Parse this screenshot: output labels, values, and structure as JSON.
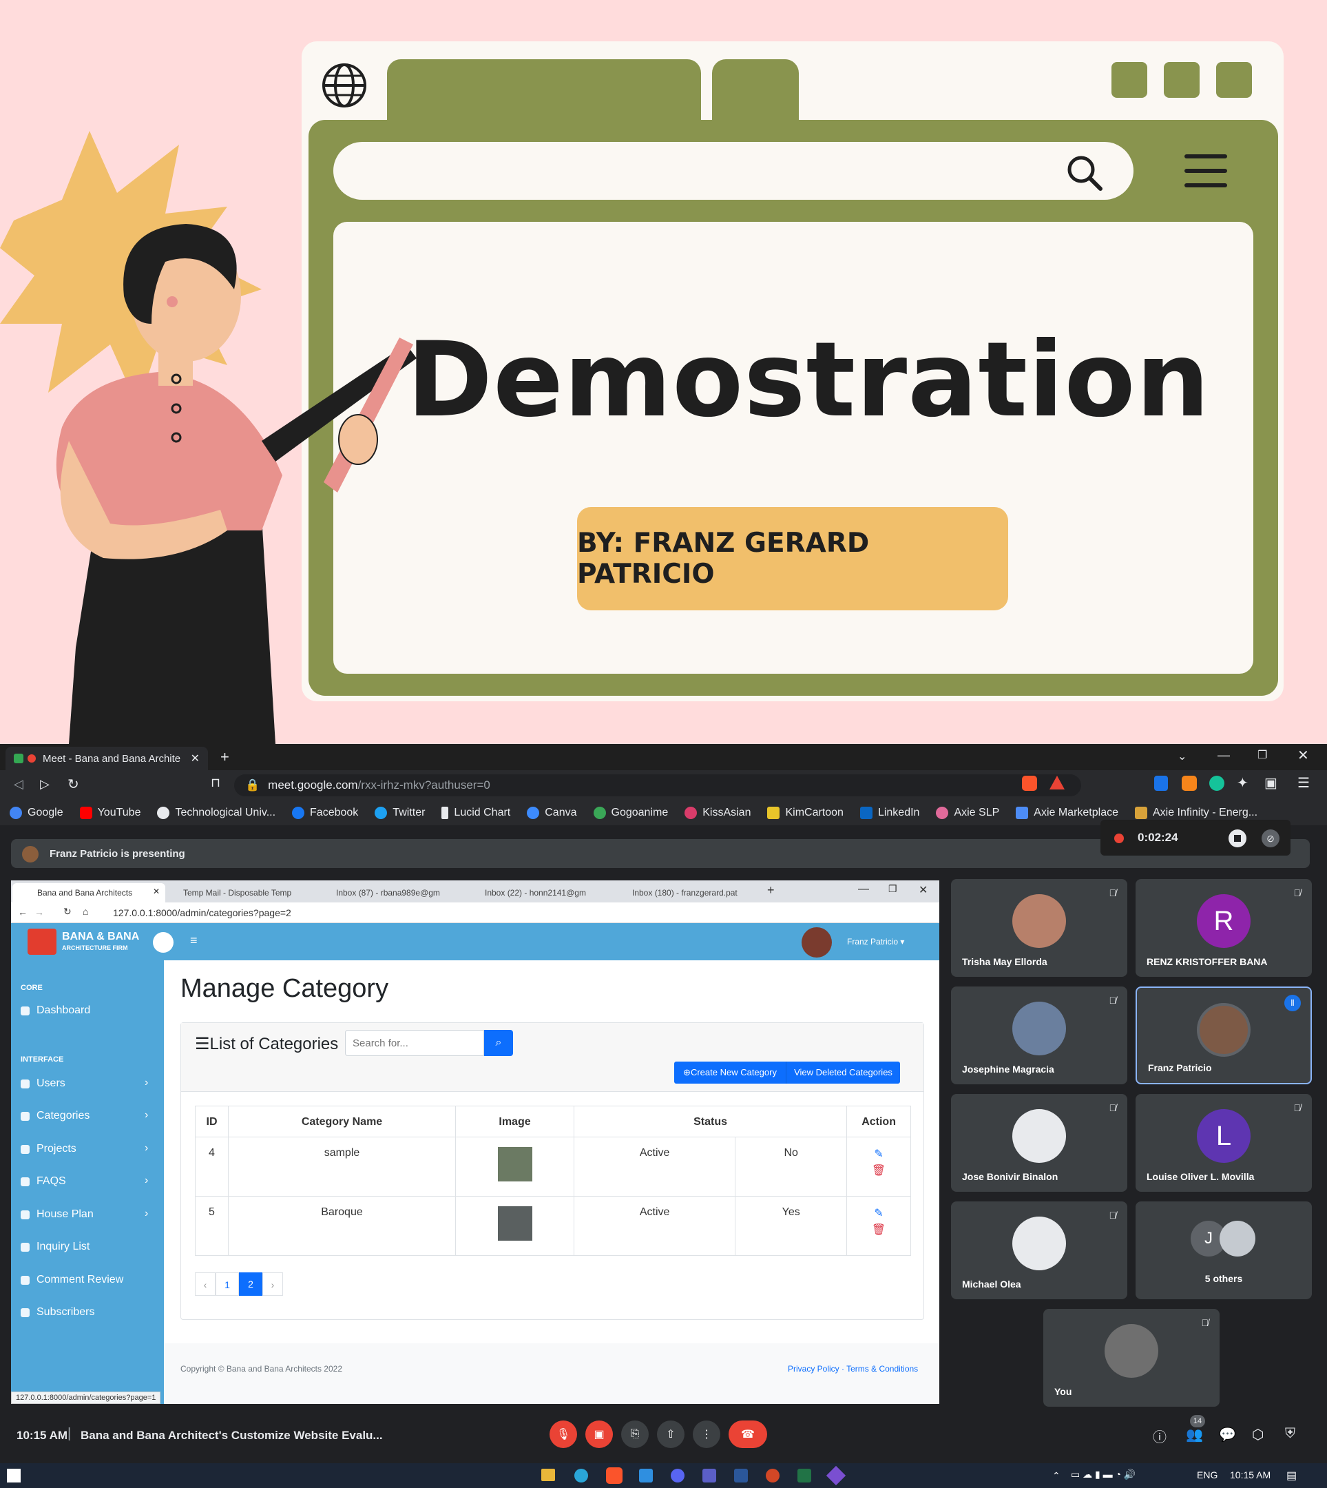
{
  "slide": {
    "title": "Demostration",
    "byline": "BY: FRANZ GERARD PATRICIO"
  },
  "chrome": {
    "tab_title": "Meet - Bana and Bana Archite",
    "url_host": "meet.google.com",
    "url_path": "/rxx-irhz-mkv?authuser=0",
    "bookmarks": [
      "Google",
      "YouTube",
      "Technological Univ...",
      "Facebook",
      "Twitter",
      "Lucid Chart",
      "Canva",
      "Gogoanime",
      "KissAsian",
      "KimCartoon",
      "LinkedIn",
      "Axie SLP",
      "Axie Marketplace",
      "Axie Infinity - Energ..."
    ]
  },
  "meet": {
    "presenting": "Franz Patricio is presenting",
    "recording_time": "0:02:24",
    "clock": "10:15 AM",
    "meeting_title": "Bana and Bana Architect's Customize Website Evalu...",
    "people_count": "14",
    "participants": [
      {
        "name": "Trisha May Ellorda",
        "initial": ""
      },
      {
        "name": "RENZ KRISTOFFER BANA",
        "initial": "R"
      },
      {
        "name": "Josephine Magracia",
        "initial": ""
      },
      {
        "name": "Franz Patricio",
        "initial": ""
      },
      {
        "name": "Jose Bonivir Binalon",
        "initial": ""
      },
      {
        "name": "Louise Oliver L. Movilla",
        "initial": "L"
      },
      {
        "name": "Michael Olea",
        "initial": ""
      },
      {
        "name": "5 others",
        "initial": "J"
      },
      {
        "name": "You",
        "initial": ""
      }
    ],
    "colors": {
      "accent": "#8ab4f8",
      "end_call": "#ea4335"
    }
  },
  "inner_browser": {
    "tabs": [
      "Bana and Bana Architects",
      "Temp Mail - Disposable Temp",
      "Inbox (87) - rbana989e@gm",
      "Inbox (22) - honn2141@gm",
      "Inbox (180) - franzgerard.pat"
    ],
    "url": "127.0.0.1:8000/admin/categories?page=2",
    "status_url": "127.0.0.1:8000/admin/categories?page=1",
    "brand_line1": "BANA & BANA",
    "brand_line2": "ARCHITECTURE FIRM",
    "user": "Franz Patricio",
    "sidebar": {
      "core_heading": "CORE",
      "interface_heading": "INTERFACE",
      "items": [
        "Dashboard",
        "Users",
        "Categories",
        "Projects",
        "FAQS",
        "House Plan",
        "Inquiry List",
        "Comment Review",
        "Subscribers"
      ]
    },
    "page_title": "Manage Category",
    "card_title": "List of Categories",
    "search_placeholder": "Search for...",
    "btn_create": "Create New Category",
    "btn_deleted": "View Deleted Categories",
    "columns": [
      "ID",
      "Category Name",
      "Image",
      "Status",
      "Action"
    ],
    "rows": [
      {
        "id": "4",
        "name": "sample",
        "status": "Active",
        "flag": "No"
      },
      {
        "id": "5",
        "name": "Baroque",
        "status": "Active",
        "flag": "Yes"
      }
    ],
    "pagination": {
      "prev": "‹",
      "pages": [
        "1",
        "2"
      ],
      "next": "›",
      "current": "2"
    },
    "footer_copy": "Copyright © Bana and Bana Architects 2022",
    "footer_links": "Privacy Policy · Terms & Conditions"
  },
  "taskbar": {
    "lang": "ENG",
    "time": "10:15 AM"
  }
}
